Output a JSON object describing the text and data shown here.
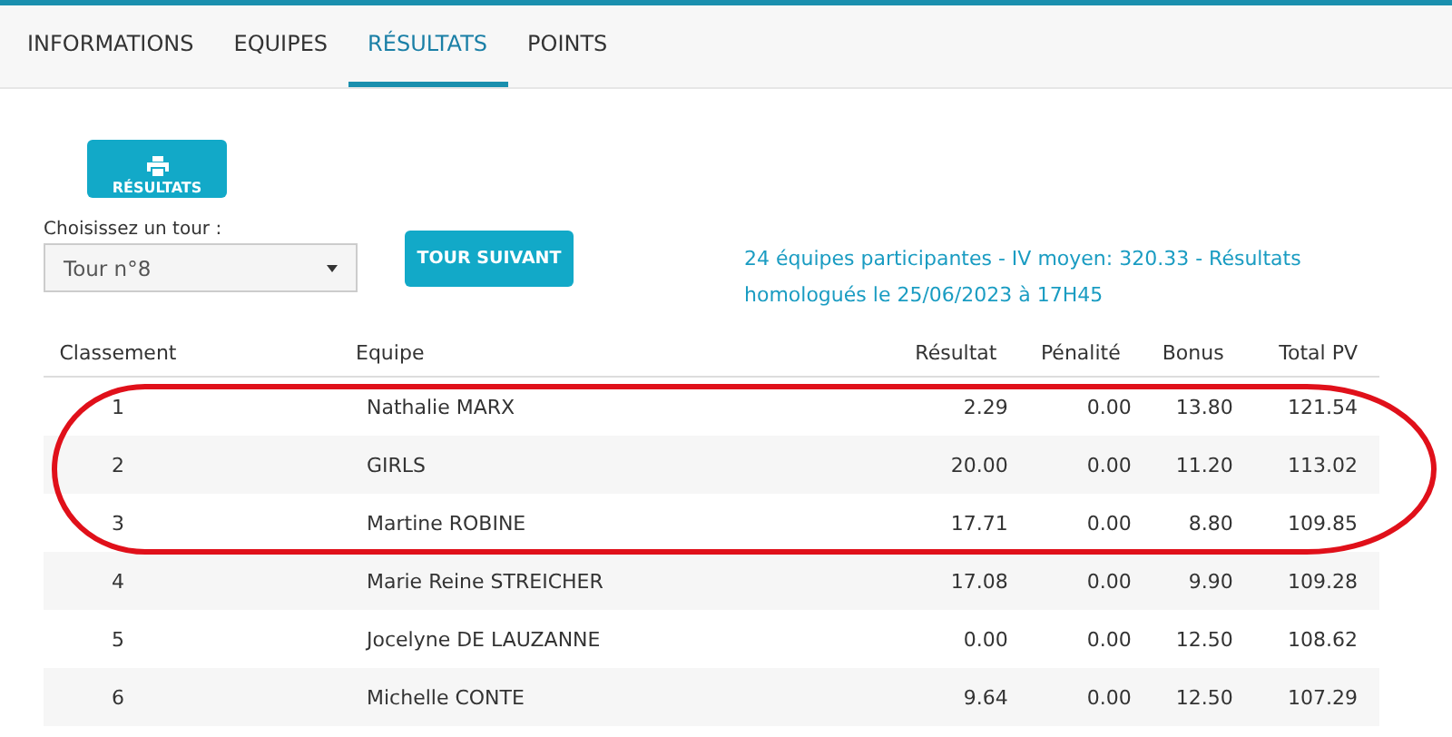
{
  "tabs": [
    {
      "label": "INFORMATIONS",
      "selected": false
    },
    {
      "label": "EQUIPES",
      "selected": false
    },
    {
      "label": "RÉSULTATS",
      "selected": true
    },
    {
      "label": "POINTS",
      "selected": false
    }
  ],
  "print_button": {
    "label": "RÉSULTATS"
  },
  "round_select": {
    "label": "Choisissez un tour :",
    "value": "Tour n°8"
  },
  "next_button": {
    "label": "TOUR SUIVANT"
  },
  "info": "24 équipes participantes - IV moyen: 320.33 - Résultats homologués le 25/06/2023 à 17H45",
  "table": {
    "columns": [
      "Classement",
      "Equipe",
      "Résultat",
      "Pénalité",
      "Bonus",
      "Total PV"
    ],
    "rows": [
      [
        "1",
        "Nathalie MARX",
        "2.29",
        "0.00",
        "13.80",
        "121.54"
      ],
      [
        "2",
        "GIRLS",
        "20.00",
        "0.00",
        "11.20",
        "113.02"
      ],
      [
        "3",
        "Martine ROBINE",
        "17.71",
        "0.00",
        "8.80",
        "109.85"
      ],
      [
        "4",
        "Marie Reine STREICHER",
        "17.08",
        "0.00",
        "9.90",
        "109.28"
      ],
      [
        "5",
        "Jocelyne DE LAUZANNE",
        "0.00",
        "0.00",
        "12.50",
        "108.62"
      ],
      [
        "6",
        "Michelle CONTE",
        "9.64",
        "0.00",
        "12.50",
        "107.29"
      ]
    ]
  },
  "annotation": {
    "kind": "ellipse"
  }
}
